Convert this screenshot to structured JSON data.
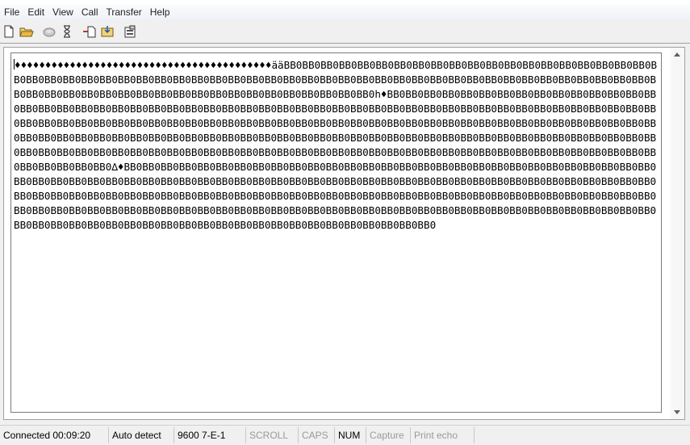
{
  "menu": [
    "File",
    "Edit",
    "View",
    "Call",
    "Transfer",
    "Help"
  ],
  "toolbar_icons": [
    "new-file-icon",
    "open-folder-icon",
    "call-icon",
    "disconnect-icon",
    "send-icon",
    "receive-icon",
    "properties-icon"
  ],
  "terminal": {
    "text": "♦♦♦♦♦♦♦♦♦♦♦♦♦♦♦♦♦♦♦♦♦♦♦♦♦♦♦♦♦♦♦♦♦♦♦♦♦♦♦♦♦♦ääBB0BB0BB0BB0BB0BB0BB0BB0BB0BB0BB0BB0BB0BB0BB0BB0BB0BB0BB0BB0BB0BB0BB0BB0BB0BB0BB0BB0BB0BB0BB0BB0BB0BB0BB0BB0BB0BB0BB0BB0BB0BB0BB0BB0BB0BB0BB0BB0BB0BB0BB0BB0BB0BB0BB0BB0BB0BB0BB0BB0BB0BB0BB0BB0BB0BB0BB0BB0BB0BB0BB0BB0BB0BB0BB0h♦BB0BB0BB0BB0BB0BB0BB0BB0BB0BB0BB0BB0BB0BB0BB0BB0BB0BB0BB0BB0BB0BB0BB0BB0BB0BB0BB0BB0BB0BB0BB0BB0BB0BB0BB0BB0BB0BB0BB0BB0BB0BB0BB0BB0BB0BB0BB0BB0BB0BB0BB0BB0BB0BB0BB0BB0BB0BB0BB0BB0BB0BB0BB0BB0BB0BB0BB0BB0BB0BB0BB0BB0BB0BB0BB0BB0BB0BB0BB0BB0BB0BB0BB0BB0BB0BB0BB0BB0BB0BB0BB0BB0BB0BB0BB0BB0BB0BB0BB0BB0BB0BB0BB0BB0BB0BB0BB0BB0BB0BB0BB0BB0BB0BB0BB0BB0BB0BB0BB0BB0BB0BB0BB0BB0BB0BB0BB0BB0BB0BB0BB0BB0BB0BB0BB0BB0BB0BB0BB0BB0BB0BB0BB0BB0BB0BB0BB0BB0BB0BB0BB0BB0BB0BB0BB0BB0BB0BB0BB0BB0∆♦BB0BB0BB0BB0BB0BB0BB0BB0BB0BB0BB0BB0BB0BB0BB0BB0BB0BB0BB0BB0BB0BB0BB0BB0BB0BB0BB0BB0BB0BB0BB0BB0BB0BB0BB0BB0BB0BB0BB0BB0BB0BB0BB0BB0BB0BB0BB0BB0BB0BB0BB0BB0BB0BB0BB0BB0BB0BB0BB0BB0BB0BB0BB0BB0BB0BB0BB0BB0BB0BB0BB0BB0BB0BB0BB0BB0BB0BB0BB0BB0BB0BB0BB0BB0BB0BB0BB0BB0BB0BB0BB0BB0BB0BB0BB0BB0BB0BB0BB0BB0BB0BB0BB0BB0BB0BB0BB0BB0BB0BB0BB0BB0BB0BB0BB0BB0BB0BB0BB0BB0BB0BB0BB0BB0BB0BB0BB0BB0BB0BB0BB0BB0BB0BB0BB0BB0BB0BB0BB0BB0BB0BB0BB0BB0BB0BB0BB0BB0BB0BB0BB0BB0BB0BB0BB0BB0BB0"
  },
  "status": {
    "connection": "Connected 00:09:20",
    "detect": "Auto detect",
    "port_settings": "9600 7-E-1",
    "scroll": "SCROLL",
    "caps": "CAPS",
    "num": "NUM",
    "capture": "Capture",
    "print_echo": "Print echo"
  }
}
